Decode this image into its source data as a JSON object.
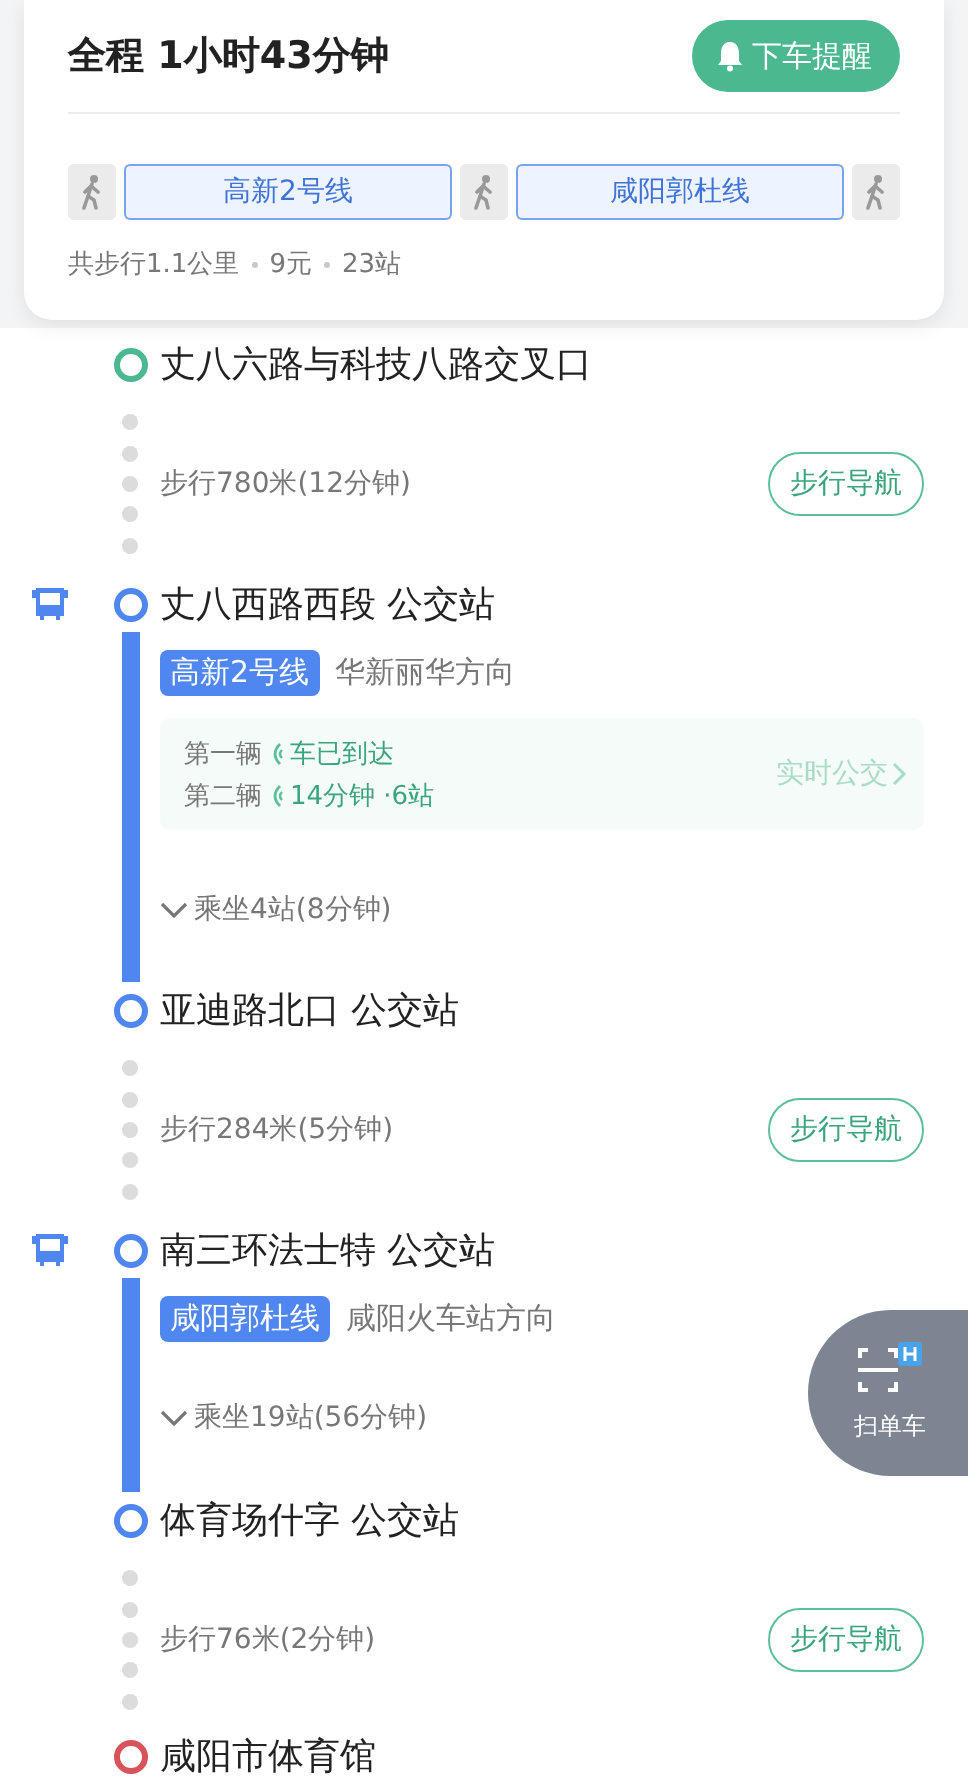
{
  "summary": {
    "title_label": "全程",
    "duration": "1小时43分钟",
    "remind_button": "下车提醒",
    "legs": [
      {
        "kind": "walk"
      },
      {
        "kind": "bus",
        "label": "高新2号线"
      },
      {
        "kind": "walk"
      },
      {
        "kind": "bus",
        "label": "咸阳郭杜线"
      },
      {
        "kind": "walk"
      }
    ],
    "stats": [
      "共步行1.1公里",
      "9元",
      "23站"
    ]
  },
  "steps": [
    {
      "kind": "start",
      "name": "丈八六路与科技八路交叉口"
    },
    {
      "kind": "walk",
      "text": "步行780米(12分钟)",
      "button": "步行导航"
    },
    {
      "kind": "bus",
      "board": "丈八西路西段 公交站",
      "line": "高新2号线",
      "direction": "华新丽华方向",
      "realtime": {
        "vehicles": [
          {
            "label": "第一辆",
            "status": "车已到达"
          },
          {
            "label": "第二辆",
            "status": "14分钟 ·6站"
          }
        ],
        "link": "实时公交"
      },
      "ride": "乘坐4站(8分钟)",
      "expanded": false,
      "alight": "亚迪路北口 公交站"
    },
    {
      "kind": "walk",
      "text": "步行284米(5分钟)",
      "button": "步行导航"
    },
    {
      "kind": "bus",
      "board": "南三环法士特 公交站",
      "line": "咸阳郭杜线",
      "direction": "咸阳火车站方向",
      "ride": "乘坐19站(56分钟)",
      "expanded": false,
      "alight": "体育场什字 公交站"
    },
    {
      "kind": "walk",
      "text": "步行76米(2分钟)",
      "button": "步行导航"
    },
    {
      "kind": "end",
      "name": "咸阳市体育馆"
    }
  ],
  "scan_button": {
    "label": "扫单车"
  }
}
